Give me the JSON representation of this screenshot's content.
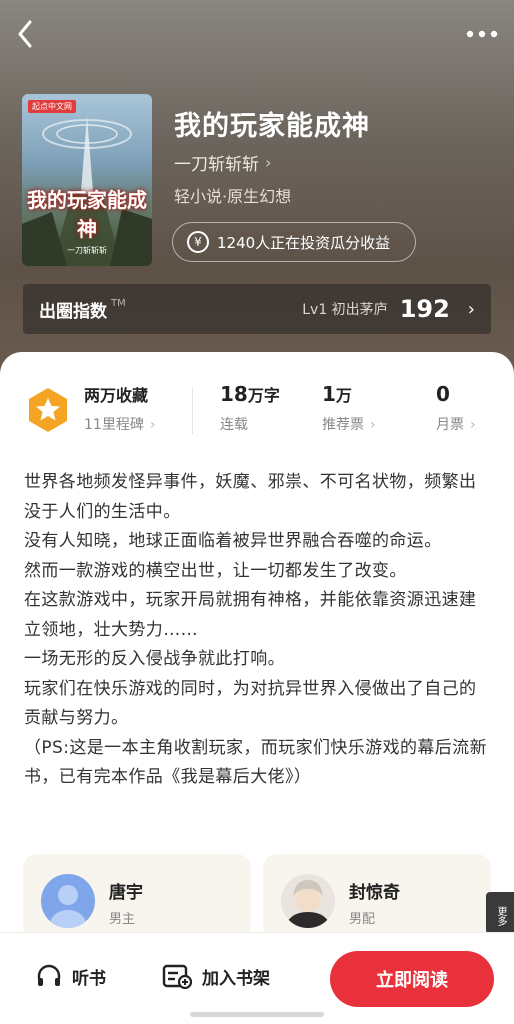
{
  "header": {
    "back_icon": "chevron-left-icon",
    "more_icon": "more-dots-icon"
  },
  "book": {
    "cover_tag": "起点中文网",
    "cover_title": "我的玩家能成神",
    "cover_author": "一刀斩斩斩",
    "title": "我的玩家能成神",
    "author": "一刀斩斩斩",
    "genre": "轻小说·原生幻想",
    "invest_text": "1240人正在投资瓜分收益"
  },
  "index": {
    "label": "出圈指数",
    "tm": "TM",
    "level": "Lv1 初出茅庐",
    "value": "192"
  },
  "stats": {
    "milestone_title": "两万收藏",
    "milestone_sub": "11里程碑",
    "words_value": "18",
    "words_unit": "万字",
    "words_label": "连载",
    "tickets_value": "1",
    "tickets_unit": "万",
    "tickets_label": "推荐票",
    "monthly_value": "0",
    "monthly_label": "月票"
  },
  "description": [
    "世界各地频发怪异事件，妖魔、邪祟、不可名状物，频繁出没于人们的生活中。",
    "没有人知晓，地球正面临着被异世界融合吞噬的命运。",
    "然而一款游戏的横空出世，让一切都发生了改变。",
    "在这款游戏中，玩家开局就拥有神格，并能依靠资源迅速建立领地，壮大势力……",
    "一场无形的反入侵战争就此打响。",
    "玩家们在快乐游戏的同时，为对抗异世界入侵做出了自己的贡献与努力。",
    "（PS:这是一本主角收割玩家，而玩家们快乐游戏的幕后流新书，已有完本作品《我是幕后大佬》）"
  ],
  "characters": [
    {
      "name": "唐宇",
      "role": "男主"
    },
    {
      "name": "封惊奇",
      "role": "男配"
    }
  ],
  "more_tab": "更多",
  "bottom": {
    "listen_label": "听书",
    "shelf_label": "加入书架",
    "read_label": "立即阅读"
  },
  "colors": {
    "accent": "#e8313b",
    "badge": "#f5a524"
  }
}
